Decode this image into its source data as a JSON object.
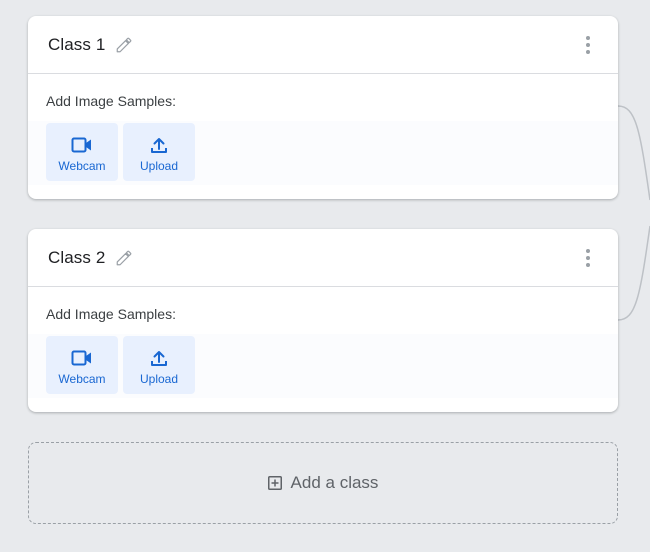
{
  "classes": [
    {
      "name": "Class 1",
      "samples_label": "Add Image Samples:",
      "webcam_label": "Webcam",
      "upload_label": "Upload"
    },
    {
      "name": "Class 2",
      "samples_label": "Add Image Samples:",
      "webcam_label": "Webcam",
      "upload_label": "Upload"
    }
  ],
  "add_class": {
    "label": "Add a class"
  },
  "icons": {
    "edit": "pencil-icon",
    "menu": "more-vert-icon",
    "webcam": "videocam-icon",
    "upload": "upload-icon",
    "add": "add-box-icon"
  },
  "colors": {
    "background": "#e8eaed",
    "card": "#ffffff",
    "accent": "#1967d2",
    "button_bg": "#e8f0fe",
    "text_primary": "#202124",
    "text_secondary": "#5f6368"
  }
}
